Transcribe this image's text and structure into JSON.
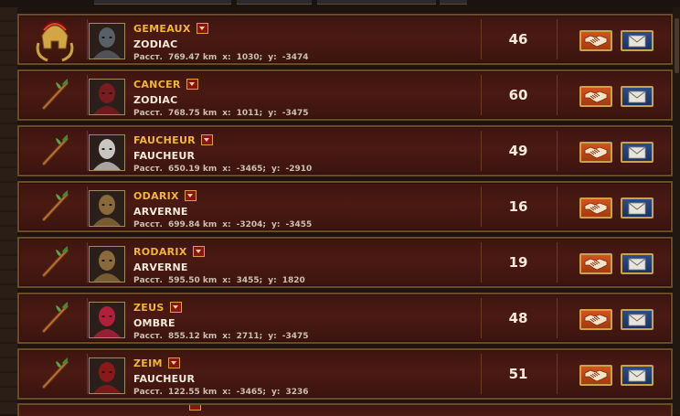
{
  "players": [
    {
      "name": "GEMEAUX",
      "alliance": "ZODIAC",
      "dist_label": "Расст.",
      "distance": "769.47 km",
      "x_label": "x:",
      "x": "1030;",
      "y_label": "y:",
      "y": "-3474",
      "score": "46",
      "rank_icon": "spartan-helmet-icon",
      "portrait_color": "#5a5f66"
    },
    {
      "name": "CANCER",
      "alliance": "ZODIAC",
      "dist_label": "Расст.",
      "distance": "768.75 km",
      "x_label": "x:",
      "x": "1011;",
      "y_label": "y:",
      "y": "-3475",
      "score": "60",
      "rank_icon": "wooden-staff-icon",
      "portrait_color": "#7a1b1f"
    },
    {
      "name": "FAUCHEUR",
      "alliance": "FAUCHEUR",
      "dist_label": "Расст.",
      "distance": "650.19 km",
      "x_label": "x:",
      "x": "-3465;",
      "y_label": "y:",
      "y": "-2910",
      "score": "49",
      "rank_icon": "wooden-staff-icon",
      "portrait_color": "#c9c6c0"
    },
    {
      "name": "ODARIX",
      "alliance": "ARVERNE",
      "dist_label": "Расст.",
      "distance": "699.84 km",
      "x_label": "x:",
      "x": "-3204;",
      "y_label": "y:",
      "y": "-3455",
      "score": "16",
      "rank_icon": "wooden-staff-icon",
      "portrait_color": "#8a6a3a"
    },
    {
      "name": "RODARIX",
      "alliance": "ARVERNE",
      "dist_label": "Расст.",
      "distance": "595.50 km",
      "x_label": "x:",
      "x": "3455;",
      "y_label": "y:",
      "y": "1820",
      "score": "19",
      "rank_icon": "wooden-staff-icon",
      "portrait_color": "#8a6a3a"
    },
    {
      "name": "ZEUS",
      "alliance": "OMBRE",
      "dist_label": "Расст.",
      "distance": "855.12 km",
      "x_label": "x:",
      "x": "2711;",
      "y_label": "y:",
      "y": "-3475",
      "score": "48",
      "rank_icon": "wooden-staff-icon",
      "portrait_color": "#b0203a"
    },
    {
      "name": "ZEIM",
      "alliance": "FAUCHEUR",
      "dist_label": "Расст.",
      "distance": "122.55 km",
      "x_label": "x:",
      "x": "-3465;",
      "y_label": "y:",
      "y": "3236",
      "score": "51",
      "rank_icon": "wooden-staff-icon",
      "portrait_color": "#8a1a1a"
    }
  ],
  "actions": {
    "trade_icon": "handshake-icon",
    "mail_icon": "envelope-icon"
  },
  "colors": {
    "name": "#f2b632",
    "panel": "#4a1a12",
    "border": "#6b4a24",
    "trade": "#c24a18",
    "mail": "#22407a"
  }
}
